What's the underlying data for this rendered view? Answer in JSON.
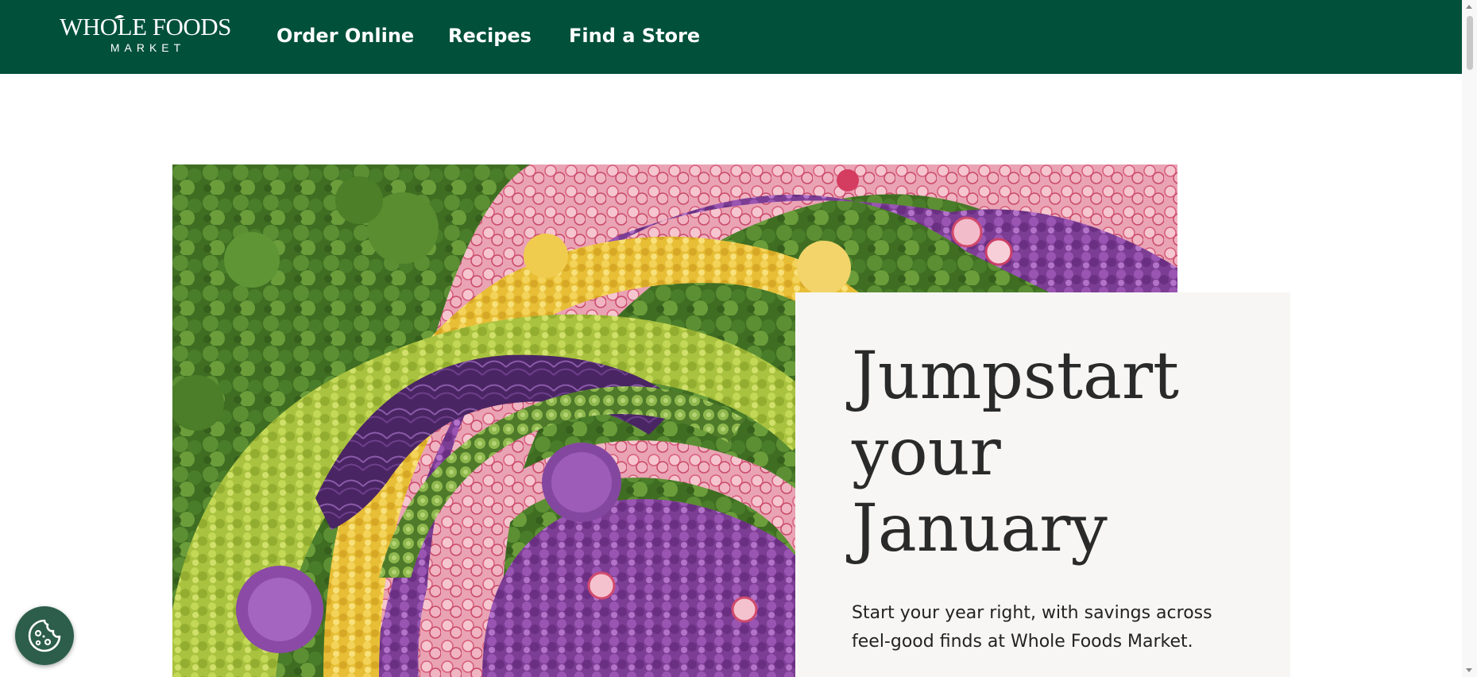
{
  "brand": {
    "logo_main": "WHOLE FOODS",
    "logo_sub": "MARKET"
  },
  "nav": {
    "items": [
      {
        "label": "Order Online"
      },
      {
        "label": "Recipes"
      },
      {
        "label": "Find a Store"
      }
    ]
  },
  "hero": {
    "title_lines": [
      "Jumpstart",
      "your",
      "January"
    ],
    "subtitle_line1": "Start your year right, with savings across",
    "subtitle_line2": "feel-good finds at Whole Foods Market.",
    "image_icon": "vegetable-rainbow-photo"
  },
  "cookie_button": {
    "icon": "cookie-icon"
  },
  "colors": {
    "nav_bg": "#00503a",
    "card_bg": "#f7f6f4",
    "cookie_bg": "#2c5e4b",
    "text_dark": "#2a2a2a"
  }
}
